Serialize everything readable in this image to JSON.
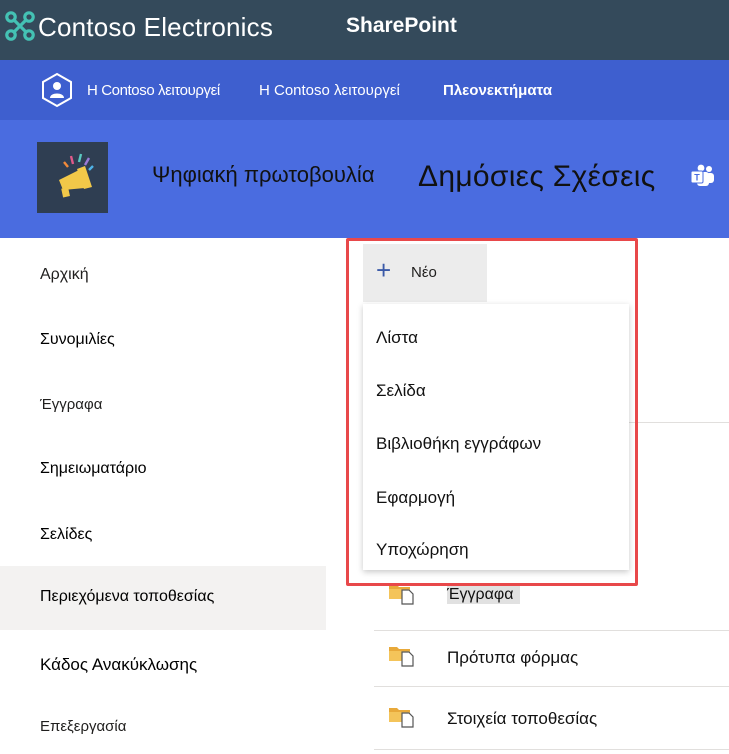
{
  "suite_bar": {
    "org_name": "Contoso Electronics",
    "app_name": "SharePoint",
    "waffle_icon": "drone-logo-icon",
    "colors": {
      "background": "#344a5b",
      "text": "#ffffff",
      "logo_accent": "#44c2b4"
    }
  },
  "hub_nav": {
    "logo_icon": "person-shield-icon",
    "items": [
      {
        "label": "Η Contoso λειτουργεί"
      },
      {
        "label": "Η Contoso λειτουργεί"
      },
      {
        "label": "Πλεονεκτήματα"
      }
    ],
    "colors": {
      "background": "#3e5fcf"
    }
  },
  "site_header": {
    "logo_icon": "megaphone-icon",
    "site_name": "Ψηφιακή πρωτοβουλία",
    "page_title": "Δημόσιες Σχέσεις",
    "teams_icon": "teams-icon",
    "colors": {
      "background": "#4a6ce0"
    }
  },
  "left_nav": {
    "items": [
      {
        "label": "Αρχική"
      },
      {
        "label": "Συνομιλίες"
      },
      {
        "label": "Έγγραφα"
      },
      {
        "label": "Σημειωματάριο"
      },
      {
        "label": "Σελίδες"
      },
      {
        "label": "Περιεχόμενα τοποθεσίας",
        "selected": true
      },
      {
        "label": "Κάδος Ανακύκλωσης"
      },
      {
        "label": "Επεξεργασία"
      }
    ]
  },
  "toolbar": {
    "new_label": "Νέο",
    "new_icon": "plus-icon"
  },
  "new_menu": {
    "items": [
      {
        "label": "Λίστα"
      },
      {
        "label": "Σελίδα"
      },
      {
        "label": "Βιβλιοθήκη εγγράφων"
      },
      {
        "label": "Εφαρμογή"
      },
      {
        "label": "Υποχώρηση"
      }
    ],
    "highlight_color": "#e8484a"
  },
  "contents": {
    "rows": [
      {
        "name": "Έγγραφα",
        "icon": "document-library-icon"
      },
      {
        "name": "Πρότυπα φόρμας",
        "icon": "document-library-icon"
      },
      {
        "name": "Στοιχεία τοποθεσίας",
        "icon": "document-library-icon"
      }
    ]
  }
}
